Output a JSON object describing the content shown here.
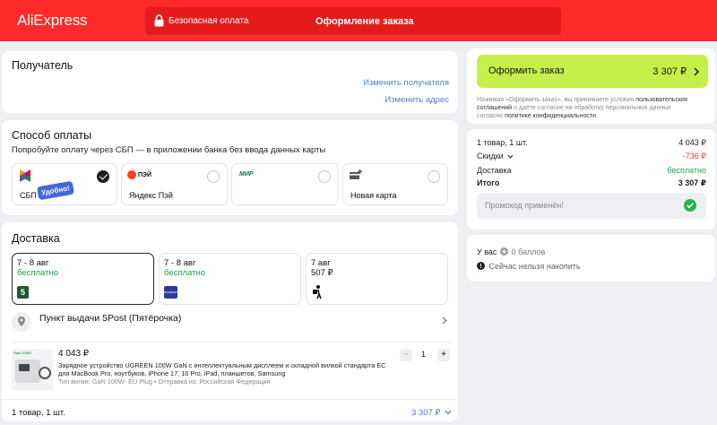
{
  "header": {
    "logo": "AliExpress",
    "secure_label": "Безопасная оплата",
    "title": "Оформление заказа"
  },
  "recipient": {
    "title": "Получатель",
    "change_recipient": "Изменить получателя",
    "change_address": "Изменить адрес"
  },
  "payment": {
    "title": "Способ оплаты",
    "hint": "Попробуйте оплату через СБП — в приложении банка без ввода данных карты",
    "options": [
      {
        "label": "СБП",
        "badge": "Удобно!",
        "selected": true
      },
      {
        "label": "Яндекс Пэй",
        "logo": "ПЭЙ",
        "selected": false
      },
      {
        "label": "",
        "logo": "МИР",
        "selected": false
      },
      {
        "label": "Новая карта",
        "selected": false
      }
    ]
  },
  "delivery": {
    "title": "Доставка",
    "options": [
      {
        "dates": "7 - 8 авг",
        "price": "бесплатно",
        "logo": "5",
        "selected": true
      },
      {
        "dates": "7 - 8 авг",
        "price": "бесплатно",
        "logo": "BOXBERRY",
        "selected": false
      },
      {
        "dates": "7 авг",
        "price": "507 ₽",
        "selected": false
      }
    ],
    "pickup_point": "Пункт выдачи 5Post (Пятёрочка)"
  },
  "product": {
    "price": "4 043 ₽",
    "desc_line1": "Зарядное устройство UGREEN 100W GaN с интеллектуальным дисплеем и складной вилкой стандарта ЕС",
    "desc_line2": "для MacBook Pro, ноутбуков, iPhone 17, 16 Pro, iPad, планшетов, Samsung",
    "meta": "Тип вилки: GaN 100W- EU Plug • Отправка из: Российская Федерация",
    "qty": "1",
    "minus": "−",
    "plus": "+",
    "thumb_label": "GaN 100W"
  },
  "footer": {
    "count": "1 товар, 1 шт.",
    "total": "3 307 ₽"
  },
  "order": {
    "button_label": "Оформить заказ",
    "button_total": "3 307 ₽",
    "legal_1": "Нажимая «Оформить заказ», вы принимаете условия ",
    "legal_link1": "пользовательских",
    "legal_2": "соглашений",
    "legal_3": " и даёте согласие на обработку персональных данных",
    "legal_4": "согласно ",
    "legal_link2": "политике конфиденциальности",
    "legal_5": "."
  },
  "summary": {
    "items_label": "1 товар, 1 шт.",
    "items_value": "4 043 ₽",
    "discount_label": "Скидки",
    "discount_value": "-736 ₽",
    "shipping_label": "Доставка",
    "shipping_value": "бесплатно",
    "total_label": "Итого",
    "total_value": "3 307 ₽",
    "promo": "Промокод применён!"
  },
  "points": {
    "balance_prefix": "У вас",
    "balance": "0 баллов",
    "cannot_earn": "Сейчас нельзя накопить"
  },
  "colors": {
    "header": "#ff2a2a",
    "accent_green": "#c5f04a",
    "link": "#4a7fd4",
    "success": "#18a348",
    "discount": "#e8383d"
  }
}
